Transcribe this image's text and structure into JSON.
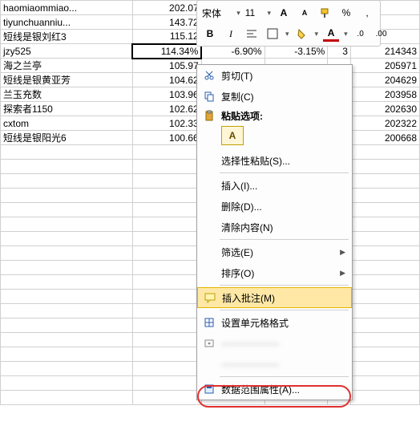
{
  "toolbar": {
    "font_name": "宋体",
    "font_size": "11",
    "grow_icon": "A",
    "shrink_icon": "A",
    "percent": "%",
    "comma": ",",
    "bold": "B",
    "italic": "I"
  },
  "cells": {
    "rows": [
      {
        "name": "haomiaommiao...",
        "val": "202.07",
        "p1": "",
        "p2": "",
        "s": "",
        "big": ""
      },
      {
        "name": "tiyunchuanniu...",
        "val": "143.72",
        "p1": "",
        "p2": "",
        "s": "",
        "big": ""
      },
      {
        "name": "短线是银刘红3",
        "val": "115.12",
        "p1": "",
        "p2": "",
        "s": "",
        "big": ""
      },
      {
        "name": "jzy525",
        "val": "114.34%",
        "p1": "-6.90%",
        "p2": "-3.15%",
        "s": "3",
        "big": "214343"
      },
      {
        "name": "海之兰亭",
        "val": "105.97",
        "p1": "",
        "p2": "",
        "s": "",
        "big": "205971"
      },
      {
        "name": "短线是银黄亚芳",
        "val": "104.62",
        "p1": "",
        "p2": "",
        "s": "",
        "big": "204629"
      },
      {
        "name": "兰玉充数",
        "val": "103.96",
        "p1": "",
        "p2": "",
        "s": "",
        "big": "203958"
      },
      {
        "name": "探索者1150",
        "val": "102.62",
        "p1": "",
        "p2": "",
        "s": "",
        "big": "202630"
      },
      {
        "name": "cxtom",
        "val": "102.33",
        "p1": "",
        "p2": "",
        "s": "",
        "big": "202322"
      },
      {
        "name": "短线是银阳光6",
        "val": "100.66",
        "p1": "",
        "p2": "",
        "s": "",
        "big": "200668"
      }
    ]
  },
  "menu": {
    "cut": "剪切(T)",
    "copy": "复制(C)",
    "paste_options": "粘贴选项:",
    "paste_letter": "A",
    "paste_special": "选择性粘贴(S)...",
    "insert": "插入(I)...",
    "delete": "删除(D)...",
    "clear": "清除内容(N)",
    "filter": "筛选(E)",
    "sort": "排序(O)",
    "insert_comment": "插入批注(M)",
    "format_cells": "设置单元格格式",
    "data_range_props": "数据范围属性(A)..."
  },
  "colors": {
    "accent_a": "#c00000",
    "highlight_bg": "#ffe8a6"
  }
}
